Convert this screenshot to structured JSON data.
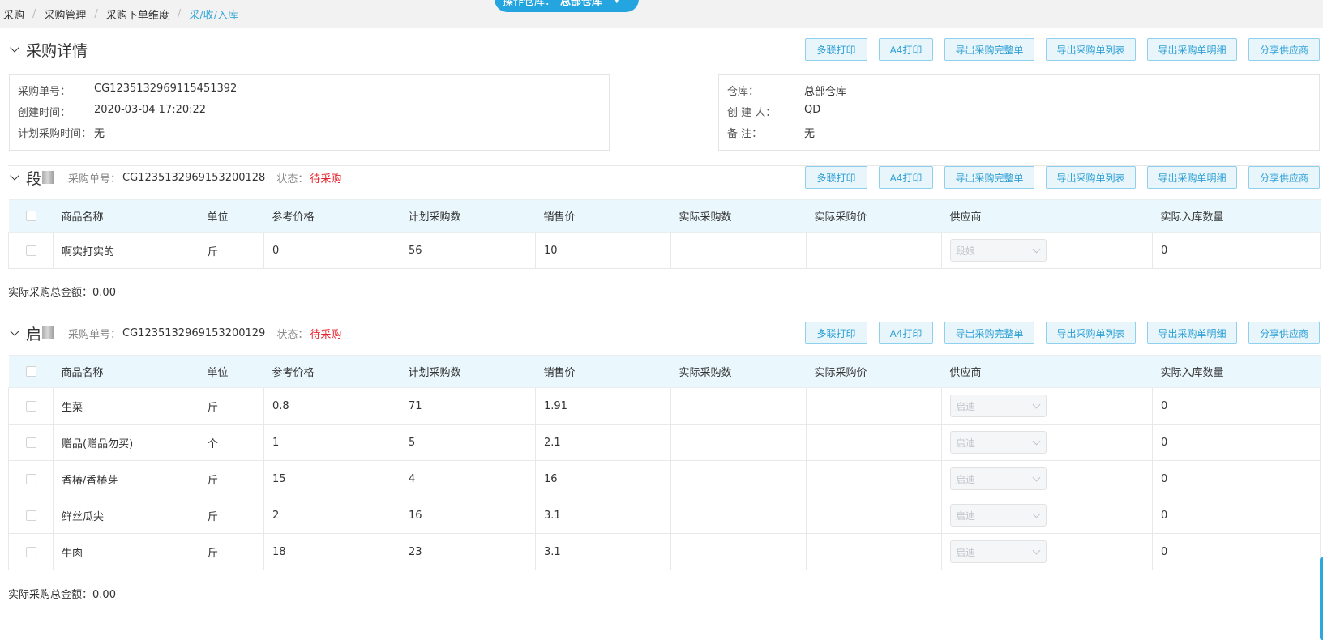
{
  "breadcrumb": [
    "采购",
    "采购管理",
    "采购下单维度",
    "采/收/入库"
  ],
  "warehouse_pill": {
    "label": "操作仓库：",
    "value": "总部仓库"
  },
  "detail": {
    "title": "采购详情",
    "left": {
      "order_no_label": "采购单号：",
      "order_no": "CG1235132969115451392",
      "created_label": "创建时间：",
      "created": "2020-03-04 17:20:22",
      "plan_label": "计划采购时间：",
      "plan": "无"
    },
    "right": {
      "warehouse_label": "仓库：",
      "warehouse": "总部仓库",
      "creator_label": "创 建 人：",
      "creator": "QD",
      "remark_label": "备 注：",
      "remark": "无"
    }
  },
  "buttons": {
    "multi_print": "多联打印",
    "a4_print": "A4打印",
    "export_full": "导出采购完整单",
    "export_list": "导出采购单列表",
    "export_detail": "导出采购单明细",
    "share_supplier": "分享供应商"
  },
  "columns": [
    "商品名称",
    "单位",
    "参考价格",
    "计划采购数",
    "销售价",
    "实际采购数",
    "实际采购价",
    "供应商",
    "实际入库数量"
  ],
  "groups": [
    {
      "title": "段",
      "order_no_label": "采购单号：",
      "order_no": "CG1235132969153200128",
      "status_label": "状态：",
      "status": "待采购",
      "rows": [
        {
          "name": "啊实打实的",
          "unit": "斤",
          "ref_price": "0",
          "plan_qty": "56",
          "sale_price": "10",
          "actual_qty": "",
          "actual_price": "",
          "supplier": "段娘",
          "in_qty": "0"
        }
      ],
      "total_label": "实际采购总金额：",
      "total": "0.00"
    },
    {
      "title": "启",
      "order_no_label": "采购单号：",
      "order_no": "CG1235132969153200129",
      "status_label": "状态：",
      "status": "待采购",
      "rows": [
        {
          "name": "生菜",
          "unit": "斤",
          "ref_price": "0.8",
          "plan_qty": "71",
          "sale_price": "1.91",
          "actual_qty": "",
          "actual_price": "",
          "supplier": "启迪",
          "in_qty": "0"
        },
        {
          "name": "赠品(赠品勿买)",
          "unit": "个",
          "ref_price": "1",
          "plan_qty": "5",
          "sale_price": "2.1",
          "actual_qty": "",
          "actual_price": "",
          "supplier": "启迪",
          "in_qty": "0"
        },
        {
          "name": "香椿/香椿芽",
          "unit": "斤",
          "ref_price": "15",
          "plan_qty": "4",
          "sale_price": "16",
          "actual_qty": "",
          "actual_price": "",
          "supplier": "启迪",
          "in_qty": "0"
        },
        {
          "name": "鲜丝瓜尖",
          "unit": "斤",
          "ref_price": "2",
          "plan_qty": "16",
          "sale_price": "3.1",
          "actual_qty": "",
          "actual_price": "",
          "supplier": "启迪",
          "in_qty": "0"
        },
        {
          "name": "牛肉",
          "unit": "斤",
          "ref_price": "18",
          "plan_qty": "23",
          "sale_price": "3.1",
          "actual_qty": "",
          "actual_price": "",
          "supplier": "启迪",
          "in_qty": "0"
        }
      ],
      "total_label": "实际采购总金额：",
      "total": "0.00"
    }
  ],
  "colors": {
    "accent": "#2d9fd4",
    "header_bg": "#eaf7fd",
    "status_red": "#e5252d",
    "pill_bg": "#25a5e0"
  }
}
